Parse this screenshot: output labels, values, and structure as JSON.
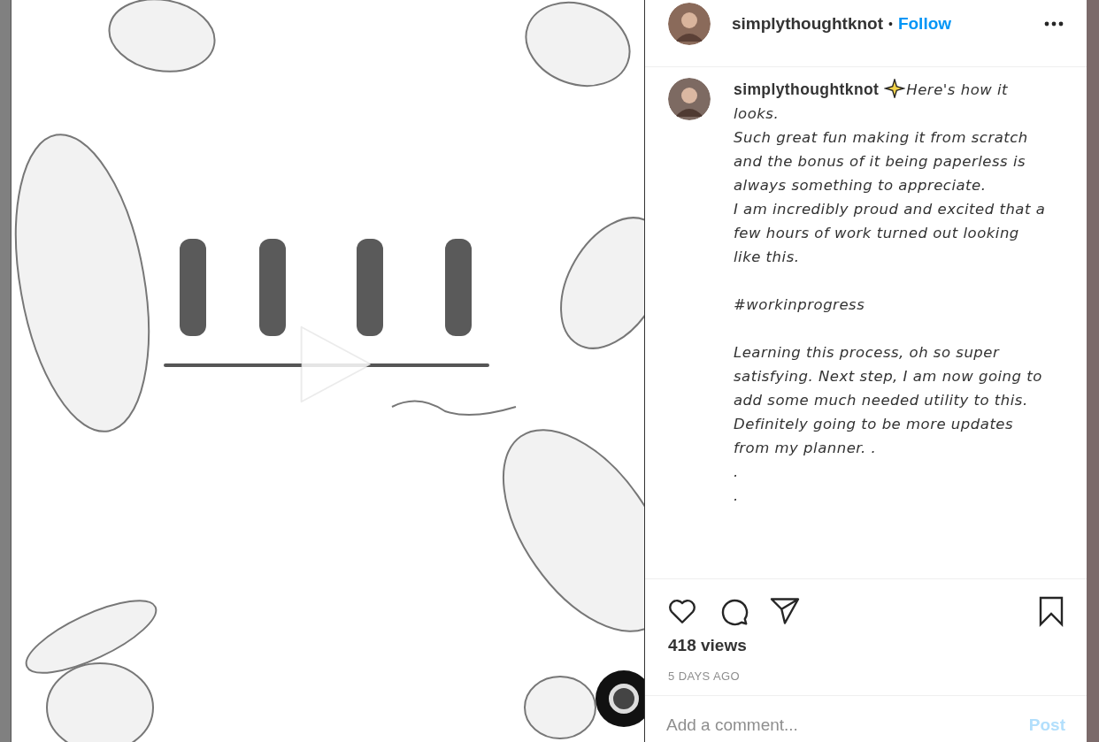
{
  "header": {
    "username": "simplythoughtknot",
    "separator": "•",
    "follow": "Follow"
  },
  "caption": {
    "author": "simplythoughtknot",
    "text": "Here's how it looks.\nSuch great fun making it from scratch and the bonus of it being paperless is always something to appreciate.\nI am incredibly proud and excited that a few hours of work turned out looking like this.\n\n#workinprogress\n\nLearning this process, oh so super satisfying. Next step, I am now going to add some much needed utility to this.\nDefinitely going to be more updates from my planner. .\n.\n."
  },
  "views": "418 views",
  "time": "5 DAYS AGO",
  "comment": {
    "placeholder": "Add a comment...",
    "post": "Post"
  }
}
